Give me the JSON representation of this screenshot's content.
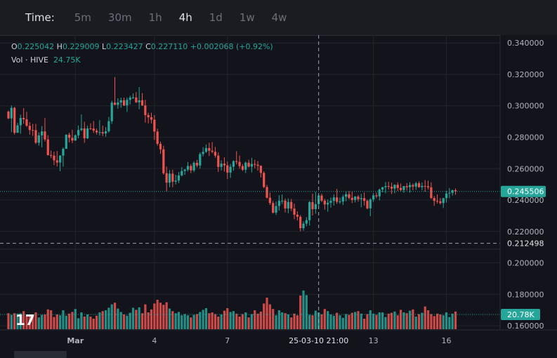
{
  "toolbar": {
    "label": "Time:",
    "timeframes": [
      "5m",
      "30m",
      "1h",
      "4h",
      "1d",
      "1w",
      "4w"
    ],
    "active": "4h"
  },
  "legend": {
    "o_label": "O",
    "o": "0.225042",
    "h_label": "H",
    "h": "0.229009",
    "l_label": "L",
    "l": "0.223427",
    "c_label": "C",
    "c": "0.227110",
    "change": "+0.002068 (+0.92%)",
    "vol_label": "Vol · HIVE",
    "vol": "24.75K"
  },
  "colors": {
    "up": "#26a69a",
    "down": "#ef5350",
    "background": "#13141b",
    "grid": "#22242c",
    "axis_text": "#b2b5be"
  },
  "chart_data": {
    "type": "candlestick",
    "interval": "4h",
    "y_ticks": [
      "0.340000",
      "0.320000",
      "0.300000",
      "0.280000",
      "0.260000",
      "0.240000",
      "0.220000",
      "0.200000",
      "0.180000",
      "0.160000"
    ],
    "ylim": [
      0.1578,
      0.345
    ],
    "x_ticks": [
      {
        "label": "Mar",
        "bar": 22
      },
      {
        "label": "4",
        "bar": 48
      },
      {
        "label": "7",
        "bar": 72
      },
      {
        "label": "13",
        "bar": 120
      },
      {
        "label": "16",
        "bar": 144
      }
    ],
    "crosshair": {
      "bar": 102,
      "label": "25-03-10 21:00"
    },
    "last_price": "0.245506",
    "crosshair_price": "0.212498",
    "volume_label": "20.78K",
    "volume_max": 1.0,
    "candles": [
      [
        0.2963,
        0.297,
        0.2915,
        0.292,
        0.38
      ],
      [
        0.292,
        0.3002,
        0.2832,
        0.2987,
        0.34
      ],
      [
        0.2987,
        0.2993,
        0.2817,
        0.2828,
        0.38
      ],
      [
        0.2828,
        0.2891,
        0.2829,
        0.2876,
        0.37
      ],
      [
        0.2876,
        0.2944,
        0.2822,
        0.2923,
        0.38
      ],
      [
        0.2923,
        0.2985,
        0.2886,
        0.2914,
        0.43
      ],
      [
        0.2914,
        0.2962,
        0.2866,
        0.2873,
        0.32
      ],
      [
        0.2873,
        0.2896,
        0.2817,
        0.2846,
        0.35
      ],
      [
        0.2846,
        0.2885,
        0.2809,
        0.2845,
        0.35
      ],
      [
        0.2845,
        0.2885,
        0.2756,
        0.2765,
        0.4
      ],
      [
        0.2765,
        0.2831,
        0.2747,
        0.2812,
        0.28
      ],
      [
        0.2812,
        0.2871,
        0.2735,
        0.2837,
        0.34
      ],
      [
        0.2837,
        0.2922,
        0.2773,
        0.2786,
        0.35
      ],
      [
        0.2786,
        0.2813,
        0.2683,
        0.2686,
        0.47
      ],
      [
        0.2686,
        0.2715,
        0.2667,
        0.2683,
        0.45
      ],
      [
        0.2683,
        0.2708,
        0.2623,
        0.2653,
        0.29
      ],
      [
        0.2653,
        0.2712,
        0.2614,
        0.2639,
        0.35
      ],
      [
        0.2639,
        0.2686,
        0.2583,
        0.2683,
        0.33
      ],
      [
        0.2683,
        0.2735,
        0.2612,
        0.2726,
        0.45
      ],
      [
        0.2726,
        0.2819,
        0.2726,
        0.2816,
        0.32
      ],
      [
        0.2816,
        0.2829,
        0.2767,
        0.2796,
        0.37
      ],
      [
        0.2796,
        0.2848,
        0.2762,
        0.2779,
        0.41
      ],
      [
        0.2779,
        0.2818,
        0.2777,
        0.2812,
        0.48
      ],
      [
        0.2812,
        0.2875,
        0.2793,
        0.2846,
        0.26
      ],
      [
        0.2846,
        0.2945,
        0.2839,
        0.2856,
        0.4
      ],
      [
        0.2856,
        0.2898,
        0.2764,
        0.2793,
        0.3
      ],
      [
        0.2793,
        0.2874,
        0.2789,
        0.2856,
        0.35
      ],
      [
        0.2856,
        0.2888,
        0.2847,
        0.2855,
        0.3
      ],
      [
        0.2855,
        0.2903,
        0.2827,
        0.2842,
        0.25
      ],
      [
        0.2842,
        0.2855,
        0.2817,
        0.2831,
        0.32
      ],
      [
        0.2831,
        0.2909,
        0.2811,
        0.2832,
        0.4
      ],
      [
        0.2832,
        0.2874,
        0.2807,
        0.2824,
        0.43
      ],
      [
        0.2824,
        0.2865,
        0.2803,
        0.2838,
        0.45
      ],
      [
        0.2838,
        0.2929,
        0.2829,
        0.2902,
        0.51
      ],
      [
        0.2902,
        0.3032,
        0.2885,
        0.302,
        0.59
      ],
      [
        0.302,
        0.3183,
        0.3004,
        0.3006,
        0.63
      ],
      [
        0.3006,
        0.3048,
        0.2982,
        0.3021,
        0.49
      ],
      [
        0.3021,
        0.3052,
        0.2987,
        0.3035,
        0.41
      ],
      [
        0.3035,
        0.3052,
        0.2999,
        0.3002,
        0.35
      ],
      [
        0.3002,
        0.3052,
        0.2961,
        0.3038,
        0.32
      ],
      [
        0.3038,
        0.3064,
        0.3008,
        0.3052,
        0.39
      ],
      [
        0.3052,
        0.3079,
        0.3044,
        0.3053,
        0.51
      ],
      [
        0.3053,
        0.3087,
        0.3018,
        0.3022,
        0.46
      ],
      [
        0.3022,
        0.3119,
        0.2978,
        0.3035,
        0.52
      ],
      [
        0.3035,
        0.3081,
        0.3,
        0.3002,
        0.38
      ],
      [
        0.3002,
        0.3038,
        0.2893,
        0.2941,
        0.59
      ],
      [
        0.2941,
        0.2956,
        0.2888,
        0.2927,
        0.4
      ],
      [
        0.2927,
        0.2956,
        0.2888,
        0.2912,
        0.47
      ],
      [
        0.2912,
        0.2941,
        0.2783,
        0.2836,
        0.61
      ],
      [
        0.2836,
        0.2854,
        0.2747,
        0.2758,
        0.7
      ],
      [
        0.2758,
        0.2772,
        0.2694,
        0.2723,
        0.63
      ],
      [
        0.2723,
        0.2745,
        0.2562,
        0.2571,
        0.58
      ],
      [
        0.2571,
        0.2613,
        0.2455,
        0.2511,
        0.64
      ],
      [
        0.2511,
        0.2591,
        0.2482,
        0.2568,
        0.49
      ],
      [
        0.2568,
        0.2593,
        0.2482,
        0.2517,
        0.43
      ],
      [
        0.2517,
        0.2561,
        0.2499,
        0.2524,
        0.38
      ],
      [
        0.2524,
        0.2579,
        0.2508,
        0.2557,
        0.41
      ],
      [
        0.2557,
        0.261,
        0.2551,
        0.2585,
        0.33
      ],
      [
        0.2585,
        0.2598,
        0.2561,
        0.2594,
        0.36
      ],
      [
        0.2594,
        0.2642,
        0.2582,
        0.2617,
        0.33
      ],
      [
        0.2617,
        0.2629,
        0.2571,
        0.2589,
        0.28
      ],
      [
        0.2589,
        0.2647,
        0.2578,
        0.2637,
        0.34
      ],
      [
        0.2637,
        0.2656,
        0.2608,
        0.262,
        0.36
      ],
      [
        0.262,
        0.2704,
        0.26,
        0.2693,
        0.41
      ],
      [
        0.2693,
        0.2737,
        0.2678,
        0.2707,
        0.46
      ],
      [
        0.2707,
        0.2754,
        0.27,
        0.2731,
        0.5
      ],
      [
        0.2731,
        0.2765,
        0.2681,
        0.2714,
        0.38
      ],
      [
        0.2714,
        0.2769,
        0.2698,
        0.2707,
        0.4
      ],
      [
        0.2707,
        0.2738,
        0.267,
        0.2683,
        0.36
      ],
      [
        0.2683,
        0.2703,
        0.2579,
        0.2611,
        0.3
      ],
      [
        0.2611,
        0.2653,
        0.2588,
        0.2632,
        0.35
      ],
      [
        0.2632,
        0.2672,
        0.2581,
        0.2621,
        0.44
      ],
      [
        0.2621,
        0.2646,
        0.2534,
        0.2575,
        0.5
      ],
      [
        0.2575,
        0.263,
        0.2541,
        0.2612,
        0.41
      ],
      [
        0.2612,
        0.2653,
        0.2587,
        0.2648,
        0.43
      ],
      [
        0.2648,
        0.2711,
        0.2627,
        0.2643,
        0.37
      ],
      [
        0.2643,
        0.2683,
        0.2599,
        0.2616,
        0.3
      ],
      [
        0.2616,
        0.2629,
        0.2585,
        0.2593,
        0.36
      ],
      [
        0.2593,
        0.2645,
        0.2572,
        0.2638,
        0.4
      ],
      [
        0.2638,
        0.2657,
        0.2607,
        0.2613,
        0.28
      ],
      [
        0.2613,
        0.2669,
        0.2576,
        0.263,
        0.36
      ],
      [
        0.263,
        0.2657,
        0.2603,
        0.2625,
        0.45
      ],
      [
        0.2625,
        0.2649,
        0.2587,
        0.2618,
        0.37
      ],
      [
        0.2618,
        0.2621,
        0.2544,
        0.2573,
        0.42
      ],
      [
        0.2573,
        0.2583,
        0.2476,
        0.2483,
        0.61
      ],
      [
        0.2483,
        0.2496,
        0.241,
        0.2415,
        0.75
      ],
      [
        0.2415,
        0.2447,
        0.2369,
        0.2381,
        0.59
      ],
      [
        0.2381,
        0.2394,
        0.2314,
        0.232,
        0.48
      ],
      [
        0.232,
        0.2391,
        0.2305,
        0.2362,
        0.33
      ],
      [
        0.2362,
        0.2431,
        0.2333,
        0.2395,
        0.45
      ],
      [
        0.2395,
        0.2436,
        0.2375,
        0.2396,
        0.4
      ],
      [
        0.2396,
        0.241,
        0.2321,
        0.2347,
        0.38
      ],
      [
        0.2347,
        0.2411,
        0.2316,
        0.2388,
        0.35
      ],
      [
        0.2388,
        0.2407,
        0.233,
        0.2346,
        0.28
      ],
      [
        0.2346,
        0.2377,
        0.2278,
        0.2307,
        0.37
      ],
      [
        0.2307,
        0.2328,
        0.227,
        0.2294,
        0.33
      ],
      [
        0.2294,
        0.2304,
        0.2201,
        0.2221,
        0.8
      ],
      [
        0.2221,
        0.2265,
        0.2205,
        0.225,
        0.92
      ],
      [
        0.225,
        0.2291,
        0.2234,
        0.2272,
        0.81
      ],
      [
        0.2272,
        0.2394,
        0.2238,
        0.2387,
        0.34
      ],
      [
        0.2387,
        0.2441,
        0.2302,
        0.2342,
        0.33
      ],
      [
        0.2342,
        0.2452,
        0.2313,
        0.2374,
        0.44
      ],
      [
        0.2374,
        0.243,
        0.2348,
        0.2429,
        0.4
      ],
      [
        0.2429,
        0.244,
        0.2387,
        0.2396,
        0.35
      ],
      [
        0.2396,
        0.2408,
        0.2339,
        0.2372,
        0.48
      ],
      [
        0.2372,
        0.2404,
        0.2326,
        0.2383,
        0.43
      ],
      [
        0.2383,
        0.2416,
        0.2352,
        0.2395,
        0.35
      ],
      [
        0.2395,
        0.2436,
        0.2365,
        0.2417,
        0.32
      ],
      [
        0.2417,
        0.2471,
        0.2376,
        0.2389,
        0.39
      ],
      [
        0.2389,
        0.2416,
        0.2376,
        0.2391,
        0.33
      ],
      [
        0.2391,
        0.2434,
        0.2368,
        0.2421,
        0.27
      ],
      [
        0.2421,
        0.2453,
        0.2392,
        0.2437,
        0.36
      ],
      [
        0.2437,
        0.2457,
        0.2405,
        0.2414,
        0.34
      ],
      [
        0.2414,
        0.2454,
        0.2381,
        0.2401,
        0.39
      ],
      [
        0.2401,
        0.2426,
        0.2385,
        0.2422,
        0.41
      ],
      [
        0.2422,
        0.2432,
        0.239,
        0.2405,
        0.43
      ],
      [
        0.2405,
        0.244,
        0.2355,
        0.2412,
        0.37
      ],
      [
        0.2412,
        0.2448,
        0.2365,
        0.2395,
        0.25
      ],
      [
        0.2395,
        0.2404,
        0.2341,
        0.2347,
        0.36
      ],
      [
        0.2347,
        0.2412,
        0.2297,
        0.2404,
        0.45
      ],
      [
        0.2404,
        0.2445,
        0.2389,
        0.243,
        0.37
      ],
      [
        0.243,
        0.2448,
        0.2412,
        0.2424,
        0.34
      ],
      [
        0.2424,
        0.2473,
        0.2398,
        0.2467,
        0.4
      ],
      [
        0.2467,
        0.2484,
        0.2449,
        0.2482,
        0.4
      ],
      [
        0.2482,
        0.2515,
        0.2443,
        0.2489,
        0.29
      ],
      [
        0.2489,
        0.2517,
        0.2468,
        0.2485,
        0.37
      ],
      [
        0.2485,
        0.2511,
        0.2438,
        0.2473,
        0.39
      ],
      [
        0.2473,
        0.25,
        0.2443,
        0.2497,
        0.42
      ],
      [
        0.2497,
        0.2512,
        0.2458,
        0.2477,
        0.33
      ],
      [
        0.2477,
        0.2505,
        0.2454,
        0.2464,
        0.46
      ],
      [
        0.2464,
        0.249,
        0.2447,
        0.2489,
        0.4
      ],
      [
        0.2489,
        0.2508,
        0.2461,
        0.2482,
        0.38
      ],
      [
        0.2482,
        0.2514,
        0.2447,
        0.2496,
        0.44
      ],
      [
        0.2496,
        0.2506,
        0.2463,
        0.2486,
        0.47
      ],
      [
        0.2486,
        0.2517,
        0.2465,
        0.2507,
        0.3
      ],
      [
        0.2507,
        0.2519,
        0.2479,
        0.2482,
        0.36
      ],
      [
        0.2482,
        0.2512,
        0.2463,
        0.249,
        0.39
      ],
      [
        0.249,
        0.2527,
        0.2454,
        0.2488,
        0.54
      ],
      [
        0.2488,
        0.2524,
        0.2467,
        0.2481,
        0.45
      ],
      [
        0.2481,
        0.2513,
        0.2407,
        0.2413,
        0.36
      ],
      [
        0.2413,
        0.2426,
        0.2363,
        0.2395,
        0.31
      ],
      [
        0.2395,
        0.2436,
        0.2378,
        0.2392,
        0.37
      ],
      [
        0.2392,
        0.2413,
        0.2372,
        0.2381,
        0.35
      ],
      [
        0.2381,
        0.2414,
        0.235,
        0.2412,
        0.33
      ],
      [
        0.2412,
        0.2459,
        0.2384,
        0.2442,
        0.4
      ],
      [
        0.2442,
        0.2477,
        0.2411,
        0.2446,
        0.29
      ],
      [
        0.2446,
        0.2466,
        0.2429,
        0.2463,
        0.37
      ],
      [
        0.2463,
        0.2474,
        0.2434,
        0.2455,
        0.42
      ]
    ]
  }
}
